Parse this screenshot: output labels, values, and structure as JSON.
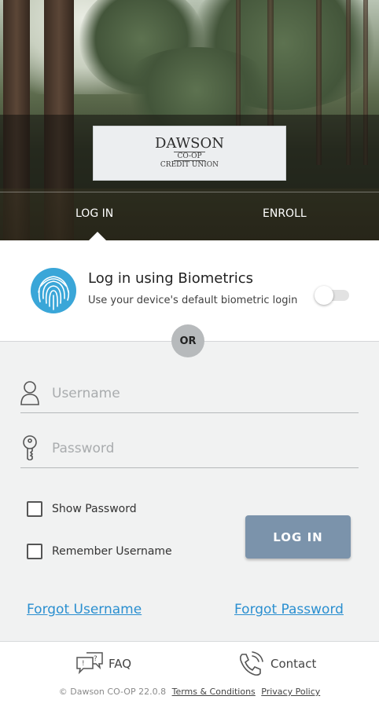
{
  "header": {
    "logo": {
      "line1": "DAWSON",
      "line2": "CO-OP",
      "line3": "CREDIT UNION"
    },
    "tabs": [
      {
        "label": "LOG IN",
        "active": true
      },
      {
        "label": "ENROLL",
        "active": false
      }
    ]
  },
  "biometrics": {
    "title": "Log in using Biometrics",
    "subtitle": "Use your device's default biometric login",
    "enabled": false,
    "icon": "fingerprint-icon"
  },
  "divider": {
    "label": "OR"
  },
  "form": {
    "username": {
      "placeholder": "Username",
      "value": "",
      "icon": "user-icon"
    },
    "password": {
      "placeholder": "Password",
      "value": "",
      "icon": "key-icon"
    },
    "show_password": {
      "label": "Show Password",
      "checked": false
    },
    "remember_username": {
      "label": "Remember Username",
      "checked": false
    },
    "login_button": "LOG IN",
    "forgot_username": "Forgot Username",
    "forgot_password": "Forgot Password"
  },
  "footer": {
    "faq": {
      "label": "FAQ",
      "icon": "faq-chat-icon"
    },
    "contact": {
      "label": "Contact",
      "icon": "phone-icon"
    },
    "copyright": "© Dawson CO-OP 22.0.8",
    "terms": "Terms & Conditions",
    "privacy": "Privacy Policy"
  },
  "colors": {
    "accent_link": "#2a8fd0",
    "login_button": "#7b93ab",
    "fingerprint": "#3aa6d8",
    "form_background": "#f1f2f2"
  }
}
